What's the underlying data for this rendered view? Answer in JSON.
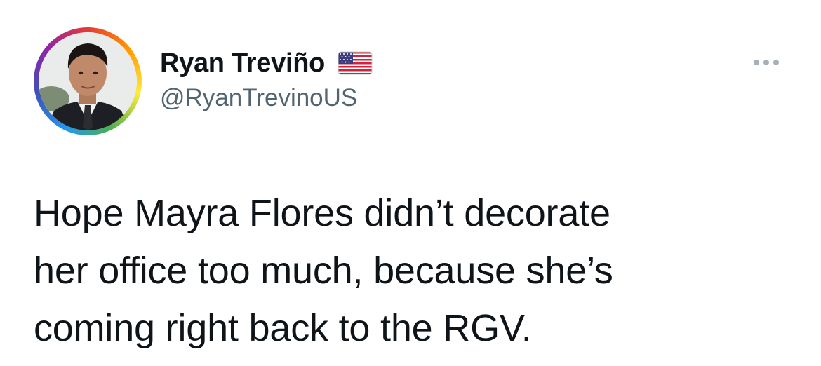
{
  "author": {
    "display_name": "Ryan Treviño",
    "handle": "@RyanTrevinoUS",
    "badge_icon": "us-flag-icon",
    "avatar_ring_colors": [
      "#e53935",
      "#ff9800",
      "#ffeb3b",
      "#4caf50",
      "#2196f3",
      "#8e24aa"
    ]
  },
  "menu": {
    "icon": "more-options-icon"
  },
  "tweet": {
    "lines": [
      "Hope Mayra Flores didn’t decorate",
      "her office too much, because she’s",
      "coming right back to the RGV."
    ]
  },
  "colors": {
    "text_primary": "#0f1419",
    "text_secondary": "#536471",
    "background": "#ffffff"
  }
}
